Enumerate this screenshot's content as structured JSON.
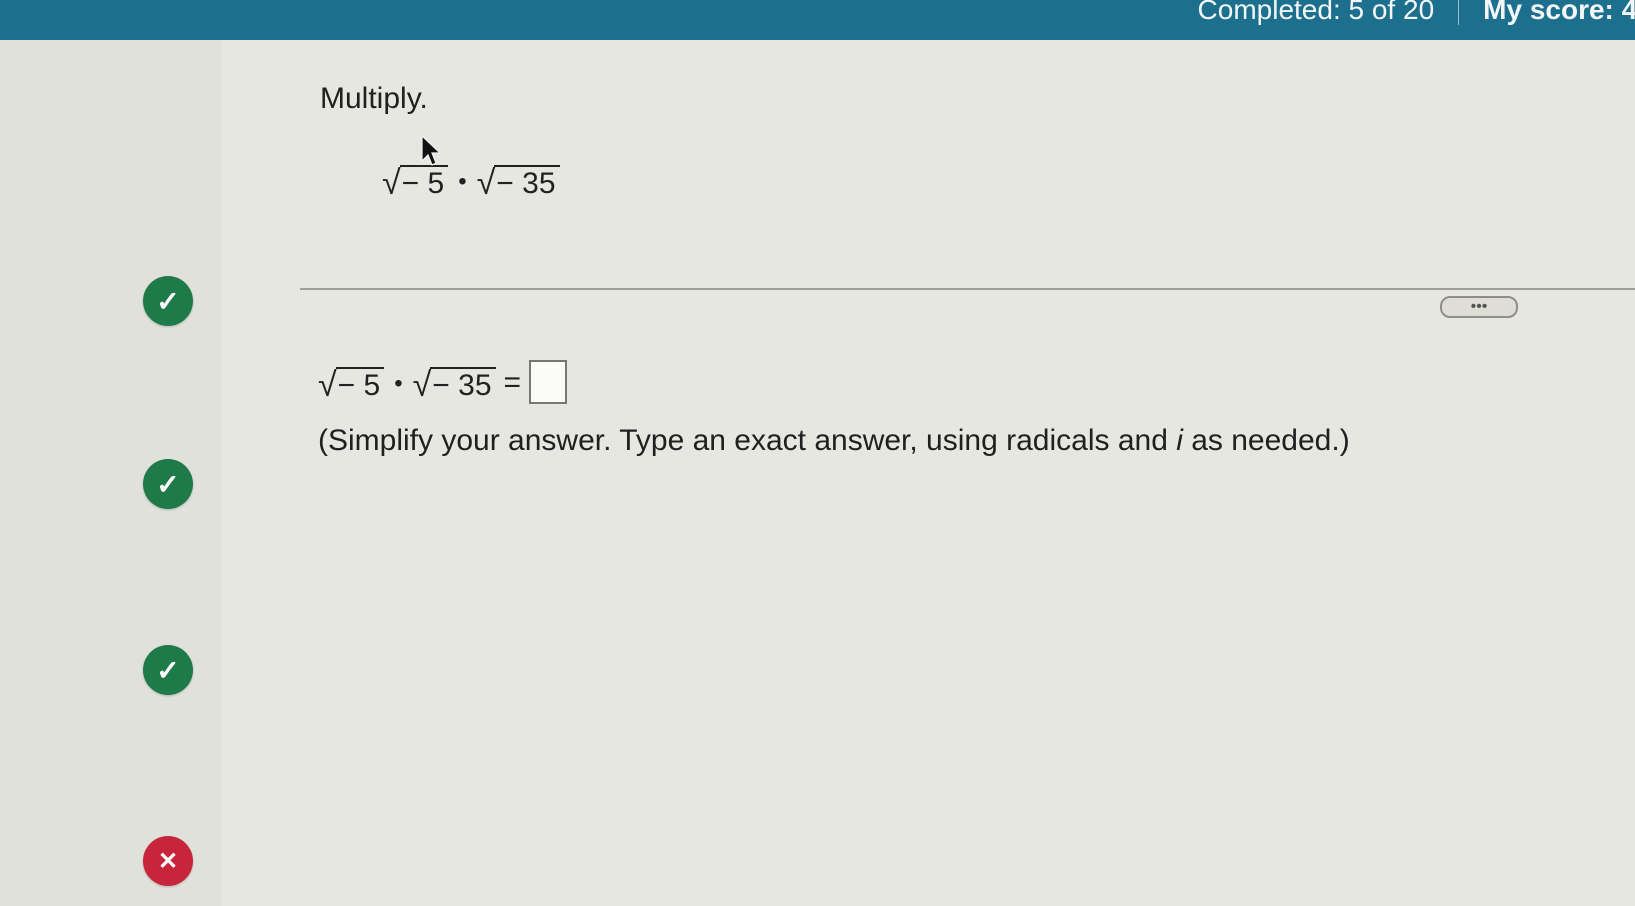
{
  "topbar": {
    "completed": "Completed: 5 of 20",
    "score": "My score: 4/"
  },
  "colors": {
    "topbar": "#1d6f8e",
    "correct": "#1f7a49",
    "incorrect": "#c6253b"
  },
  "sidebar": {
    "statuses": [
      {
        "state": "correct",
        "icon": "check-icon",
        "glyph": "✓"
      },
      {
        "state": "correct",
        "icon": "check-icon",
        "glyph": "✓"
      },
      {
        "state": "correct",
        "icon": "check-icon",
        "glyph": "✓"
      },
      {
        "state": "incorrect",
        "icon": "x-icon",
        "glyph": "✕"
      }
    ]
  },
  "question": {
    "prompt": "Multiply.",
    "expression": {
      "left_radicand": "− 5",
      "operator": "•",
      "right_radicand": "− 35"
    }
  },
  "answer": {
    "left_radicand": "− 5",
    "operator": "•",
    "right_radicand": "− 35",
    "equals": "=",
    "value": ""
  },
  "more_button_label": "•••",
  "instruction": {
    "before": "(Simplify your answer. Type an exact answer, using radicals and ",
    "variable": "i",
    "after": " as needed.)"
  }
}
